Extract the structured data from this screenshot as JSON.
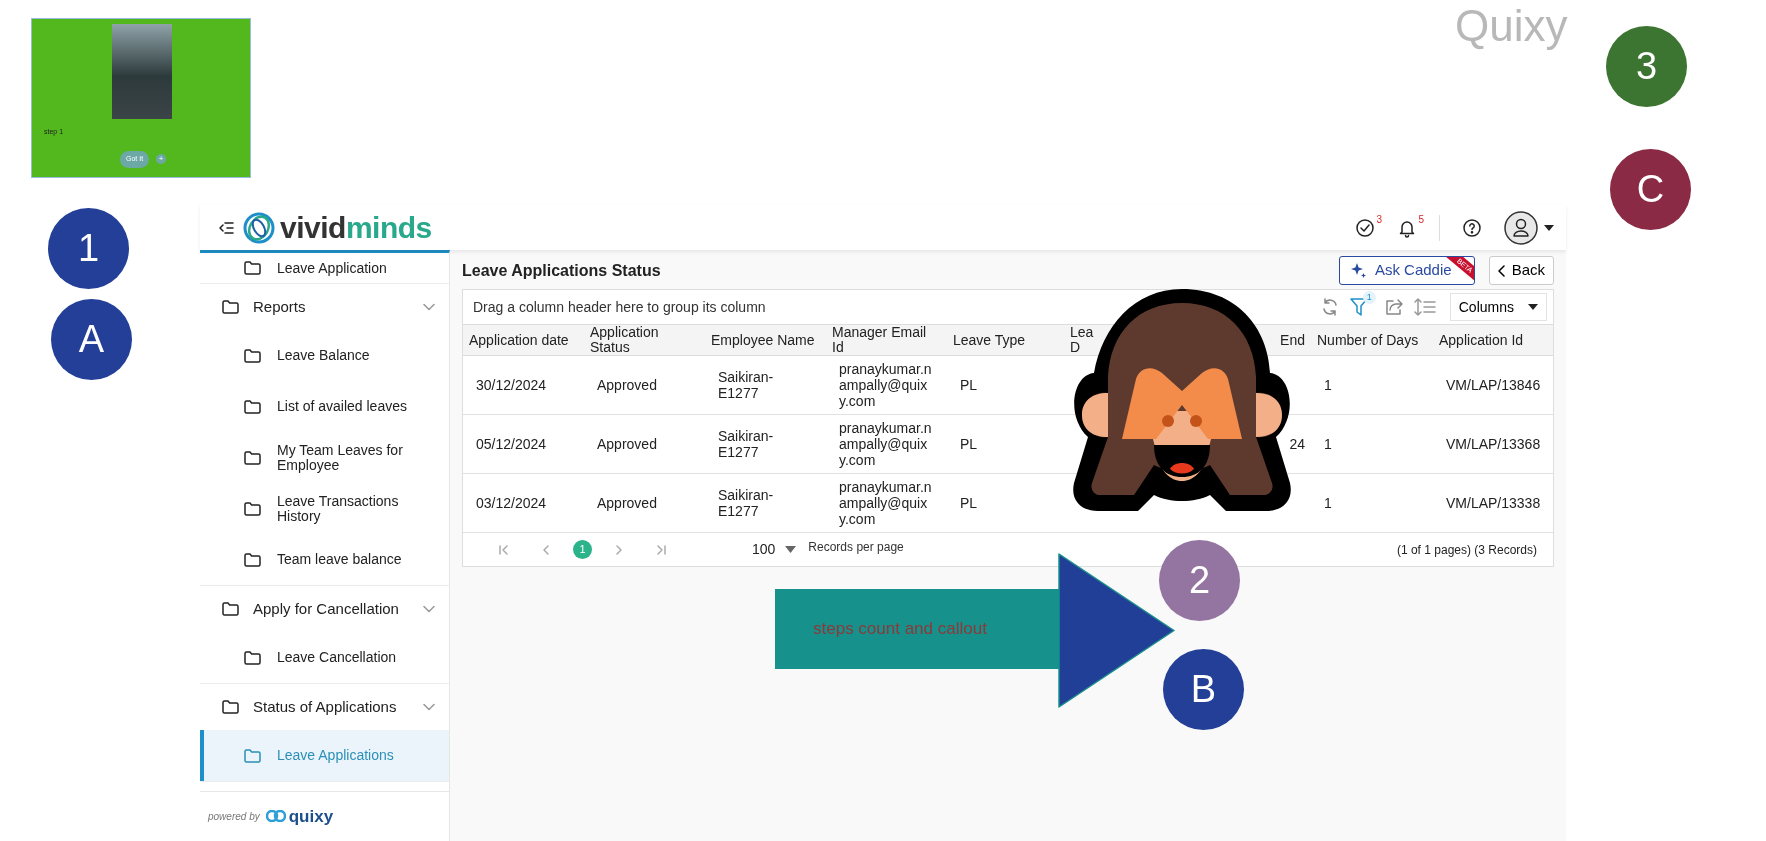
{
  "tour_card": {
    "step_text": "step 1",
    "button": "Got It",
    "add_symbol": "+"
  },
  "brand_text": "Quixy",
  "markers": [
    {
      "label": "3",
      "color": "#3c7431"
    },
    {
      "label": "C",
      "color": "#8b2a45"
    },
    {
      "label": "1",
      "color": "#233f97"
    },
    {
      "label": "A",
      "color": "#233f97"
    },
    {
      "label": "2",
      "color": "#9474a1"
    },
    {
      "label": "B",
      "color": "#233f97"
    }
  ],
  "callout": {
    "text": "steps count and callout"
  },
  "header": {
    "logo": {
      "first": "vivid",
      "second": "minds"
    },
    "tasks_count": "3",
    "notifications_count": "5"
  },
  "sidebar": {
    "groups": [
      {
        "children": [
          {
            "label": "Leave Application",
            "selected": false
          }
        ]
      },
      {
        "label": "Reports",
        "expanded": true,
        "children": [
          {
            "label": "Leave Balance",
            "selected": false
          },
          {
            "label": "List of availed leaves",
            "selected": false
          },
          {
            "label": "My Team Leaves for Employee",
            "selected": false
          },
          {
            "label": "Leave Transactions History",
            "selected": false
          },
          {
            "label": "Team leave balance",
            "selected": false
          }
        ]
      },
      {
        "label": "Apply for Cancellation",
        "expanded": true,
        "children": [
          {
            "label": "Leave Cancellation",
            "selected": false
          }
        ]
      },
      {
        "label": "Status of Applications",
        "expanded": true,
        "children": [
          {
            "label": "Leave Applications",
            "selected": true
          }
        ]
      }
    ],
    "footer": {
      "powered_by": "powered by",
      "brand": "quixy"
    }
  },
  "page": {
    "title": "Leave Applications Status",
    "ask_button": "Ask Caddie",
    "ask_ribbon": "BETA",
    "back_button": "Back"
  },
  "grid": {
    "group_hint": "Drag a column header here to group its column",
    "filter_count": "1",
    "columns_button": "Columns",
    "columns": [
      "Application date",
      "Application Status",
      "Employee Name",
      "Manager Email Id",
      "Leave Type",
      "Lea\nD",
      "End",
      "Number of Days",
      "Application Id"
    ],
    "rows": [
      {
        "application_date": "30/12/2024",
        "status": "Approved",
        "employee": "Saikiran-E1277",
        "manager_email": "pranaykumar.nampally@quixy.com",
        "leave_type": "PL",
        "days": "1",
        "application_id": "VM/LAP/13846"
      },
      {
        "application_date": "05/12/2024",
        "status": "Approved",
        "employee": "Saikiran-E1277",
        "manager_email": "pranaykumar.nampally@quixy.com",
        "leave_type": "PL",
        "leave_end_visible": "24",
        "days": "1",
        "application_id": "VM/LAP/13368"
      },
      {
        "application_date": "03/12/2024",
        "status": "Approved",
        "employee": "Saikiran-E1277",
        "manager_email": "pranaykumar.nampally@quixy.com",
        "leave_type": "PL",
        "days": "1",
        "application_id": "VM/LAP/13338"
      }
    ],
    "pager": {
      "pages": [
        {
          "label": "1",
          "selected": true
        }
      ],
      "page_size": "100",
      "page_size_label": "Records per page",
      "summary": "(1 of 1 pages) (3 Records)"
    }
  }
}
